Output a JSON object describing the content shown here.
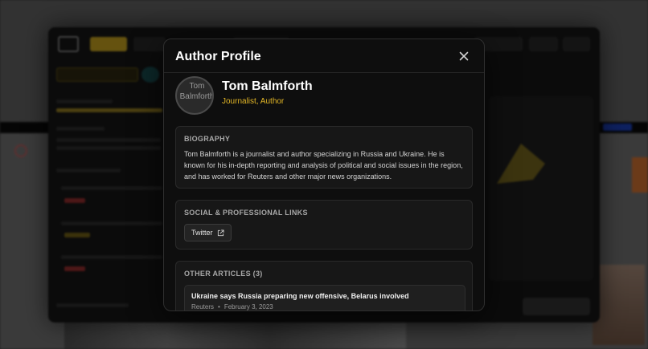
{
  "modal": {
    "title": "Author Profile",
    "close_icon": "close-icon"
  },
  "author": {
    "name": "Tom Balmforth",
    "role": "Journalist, Author",
    "avatar_alt": "Tom Balmforth"
  },
  "biography": {
    "heading": "BIOGRAPHY",
    "text": "Tom Balmforth is a journalist and author specializing in Russia and Ukraine. He is known for his in-depth reporting and analysis of political and social issues in the region, and has worked for Reuters and other major news organizations."
  },
  "links": {
    "heading": "SOCIAL & PROFESSIONAL LINKS",
    "items": [
      {
        "label": "Twitter",
        "icon": "external-link-icon"
      }
    ]
  },
  "articles": {
    "heading": "OTHER ARTICLES (3)",
    "items": [
      {
        "title": "Ukraine says Russia preparing new offensive, Belarus involved",
        "source": "Reuters",
        "separator": "•",
        "date": "February 3, 2023"
      }
    ]
  },
  "colors": {
    "accent": "#e2b626",
    "modal_bg": "#0e0e0e",
    "card_bg": "#171717"
  }
}
